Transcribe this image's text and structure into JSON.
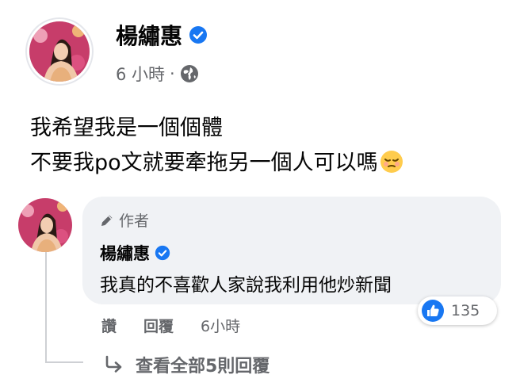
{
  "post": {
    "author": "楊繡惠",
    "time": "6 小時",
    "separator": "·",
    "lines": [
      "我希望我是一個個體",
      "不要我po文就要牽拖另一個人可以嗎"
    ]
  },
  "comment": {
    "badge": "作者",
    "author": "楊繡惠",
    "text": "我真的不喜歡人家說我利用他炒新聞",
    "reaction_count": "135",
    "actions": {
      "like": "讚",
      "reply": "回覆",
      "time": "6小時"
    },
    "view_replies": "查看全部5則回覆"
  },
  "icons": [
    "verified-badge-icon",
    "globe-icon",
    "pensive-emoji-icon",
    "pencil-icon",
    "like-reaction-icon",
    "reply-arrow-icon"
  ],
  "colors": {
    "accent": "#1877f2",
    "secondary_text": "#65676b",
    "bubble": "#f0f2f5"
  }
}
